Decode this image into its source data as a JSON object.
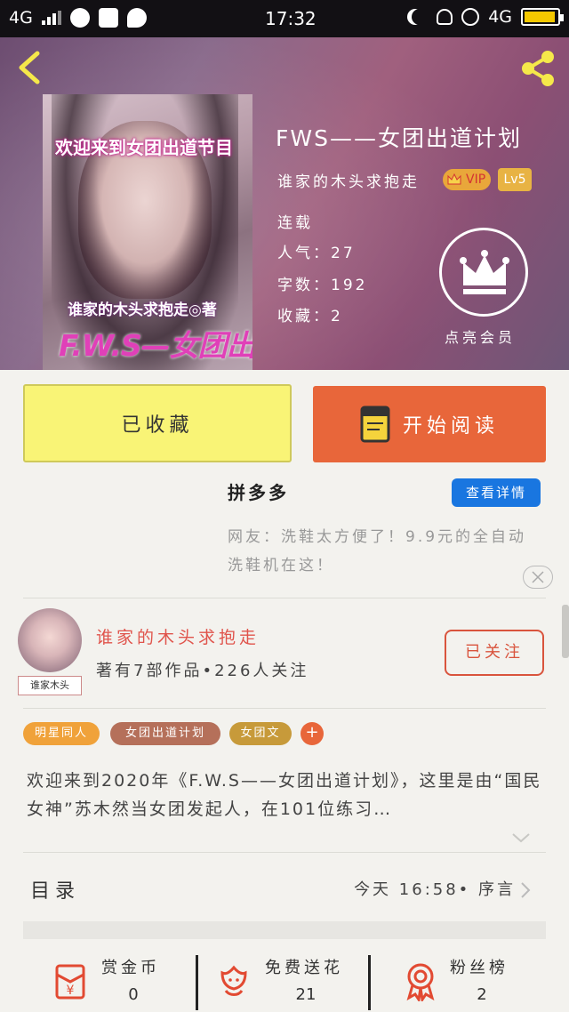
{
  "status_bar": {
    "network": "4G",
    "network_right": "4G",
    "time": "17:32",
    "battery_level": 0.95
  },
  "header": {
    "back_icon": "back-chevron-icon",
    "share_icon": "share-icon"
  },
  "book": {
    "cover_text_top": "欢迎来到女团出道节目",
    "cover_text_author": "谁家的木头求抱走◎著",
    "cover_text_title": "F.W.S—女团出道计划",
    "title": "FWS——女团出道计划",
    "author": "谁家的木头求抱走",
    "vip_label": "VIP",
    "level_label": "Lv5",
    "status": "连载",
    "popularity_label": "人气：",
    "popularity": "27",
    "word_count_label": "字数：",
    "word_count": "192",
    "favorites_label": "收藏：",
    "favorites": "2",
    "vip_member_label": "点亮会员"
  },
  "actions": {
    "collected_label": "已收藏",
    "read_label": "开始阅读"
  },
  "ad": {
    "title": "拼多多",
    "detail_button": "查看详情",
    "text": "网友：洗鞋太方便了！9.9元的全自动洗鞋机在这！"
  },
  "author_card": {
    "name": "谁家的木头求抱走",
    "stats": "著有7部作品•226人关注",
    "avatar_tag": "谁家木头",
    "follow_label": "已关注"
  },
  "tags": [
    {
      "label": "明星同人",
      "color": "#f0a23a"
    },
    {
      "label": "女团出道计划",
      "color": "#b5705a"
    },
    {
      "label": "女团文",
      "color": "#c79a3a"
    }
  ],
  "tag_add_label": "+",
  "intro": "欢迎来到2020年《F.W.S——女团出道计划》，这里是由“国民女神”苏木然当女团发起人，在101位练习…",
  "toc": {
    "label": "目录",
    "latest": "今天 16:58• 序言"
  },
  "bottom_bar": [
    {
      "label": "赏金币",
      "count": "0",
      "icon": "reward-coin-icon"
    },
    {
      "label": "免费送花",
      "count": "21",
      "icon": "flower-icon"
    },
    {
      "label": "粉丝榜",
      "count": "2",
      "icon": "fan-ranking-icon"
    }
  ]
}
